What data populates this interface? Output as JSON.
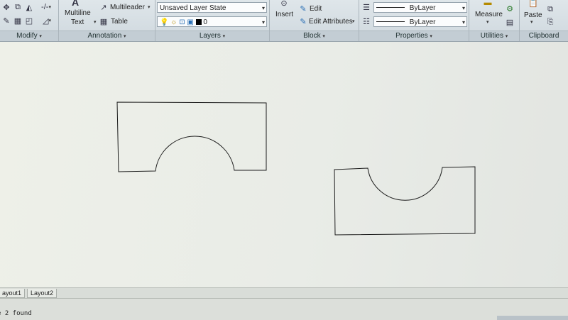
{
  "ribbon": {
    "panels": {
      "modify": "Modify",
      "annotation": "Annotation",
      "layers": "Layers",
      "block": "Block",
      "properties": "Properties",
      "utilities": "Utilities",
      "clipboard": "Clipboard"
    },
    "annotation": {
      "multiline_text_line1": "Multiline",
      "multiline_text_line2": "Text",
      "multileader": "Multileader",
      "table": "Table"
    },
    "layers": {
      "layer_state": "Unsaved Layer State",
      "current_layer": "0"
    },
    "block": {
      "insert": "Insert",
      "edit": "Edit",
      "edit_attributes": "Edit Attributes"
    },
    "properties": {
      "lineweight": "ByLayer",
      "linetype": "ByLayer"
    },
    "utilities": {
      "measure": "Measure"
    },
    "clipboard": {
      "paste": "Paste"
    }
  },
  "tabs": [
    "ayout1",
    "Layout2"
  ],
  "command_line": {
    "text": "e 2 found"
  },
  "colors": {
    "accent": "#2a6fb5",
    "canvas": "#ebede7"
  },
  "icons": [
    "pencil-icon",
    "move-icon",
    "mirror-icon",
    "trim-icon",
    "fillet-icon",
    "lightbulb-icon",
    "sun-icon",
    "lock-icon",
    "color-swatch-icon",
    "edit-block-icon",
    "edit-attributes-icon",
    "lineweight-icon",
    "linetype-icon",
    "calculator-icon",
    "copy-icon",
    "paste-special-icon"
  ]
}
